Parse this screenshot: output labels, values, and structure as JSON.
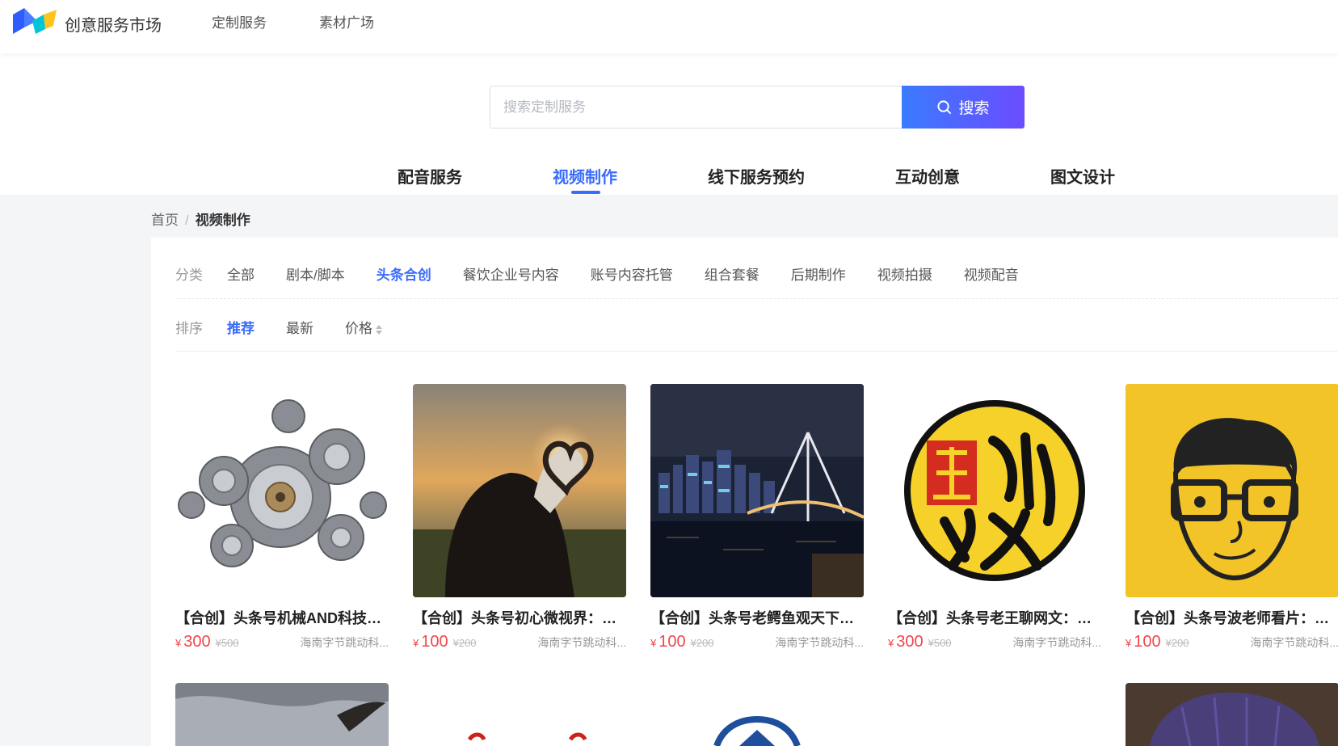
{
  "header": {
    "brand": "创意服务市场",
    "nav": [
      "定制服务",
      "素材广场"
    ]
  },
  "search": {
    "placeholder": "搜索定制服务",
    "value": "",
    "button_label": "搜索"
  },
  "category_tabs": [
    "配音服务",
    "视频制作",
    "线下服务预约",
    "互动创意",
    "图文设计"
  ],
  "active_tab": "视频制作",
  "breadcrumb": {
    "home": "首页",
    "separator": "/",
    "current": "视频制作"
  },
  "filters": {
    "category_label": "分类",
    "categories": [
      "全部",
      "剧本/脚本",
      "头条合创",
      "餐饮企业号内容",
      "账号内容托管",
      "组合套餐",
      "后期制作",
      "视频拍摄",
      "视频配音"
    ],
    "active_category": "头条合创",
    "sort_label": "排序",
    "sorts": [
      "推荐",
      "最新",
      "价格"
    ],
    "active_sort": "推荐"
  },
  "currency_symbol": "¥",
  "cards": [
    {
      "title": "【合创】头条号机械AND科技：...",
      "price": "300",
      "original_price": "¥500",
      "seller": "海南字节跳动科..."
    },
    {
      "title": "【合创】头条号初心微视界：定...",
      "price": "100",
      "original_price": "¥200",
      "seller": "海南字节跳动科..."
    },
    {
      "title": "【合创】头条号老鳄鱼观天下：...",
      "price": "100",
      "original_price": "¥200",
      "seller": "海南字节跳动科..."
    },
    {
      "title": "【合创】头条号老王聊网文：定...",
      "price": "300",
      "original_price": "¥500",
      "seller": "海南字节跳动科..."
    },
    {
      "title": "【合创】头条号波老师看片：定...",
      "price": "100",
      "original_price": "¥200",
      "seller": "海南字节跳动科..."
    }
  ],
  "colors": {
    "accent": "#3a6bff",
    "price": "#f0464a"
  }
}
